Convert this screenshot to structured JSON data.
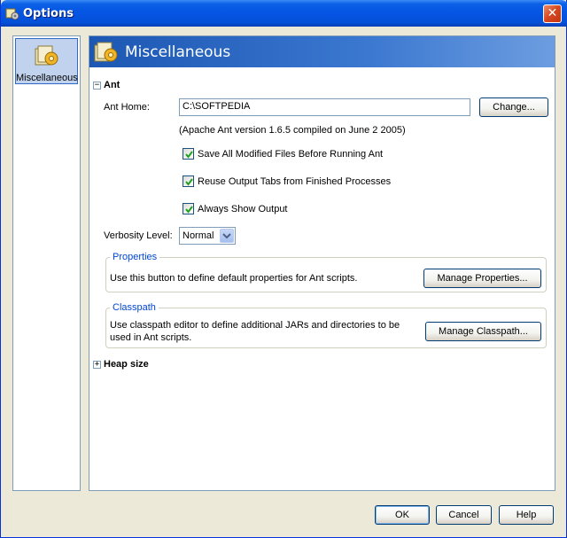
{
  "window": {
    "title": "Options",
    "close_glyph": "✕"
  },
  "categories": [
    {
      "label": "Miscellaneous",
      "icon": "gear-folder-icon",
      "selected": true
    }
  ],
  "panel": {
    "title": "Miscellaneous",
    "ant": {
      "section_label": "Ant",
      "expander": "−",
      "ant_home_label": "Ant Home:",
      "ant_home_value": "C:\\SOFTPEDIA",
      "change_button": "Change...",
      "version_info": "(Apache Ant version 1.6.5 compiled on June 2 2005)",
      "checkboxes": [
        {
          "label": "Save All Modified Files Before Running Ant",
          "checked": true
        },
        {
          "label": "Reuse Output Tabs from Finished Processes",
          "checked": true
        },
        {
          "label": "Always Show Output",
          "checked": true
        }
      ],
      "verbosity_label": "Verbosity Level:",
      "verbosity_value": "Normal",
      "properties": {
        "legend": "Properties",
        "description": "Use this button to define default properties for Ant scripts.",
        "button": "Manage Properties..."
      },
      "classpath": {
        "legend": "Classpath",
        "description_line1": "Use classpath editor to define additional JARs and directories to be",
        "description_line2": "used in Ant scripts.",
        "button": "Manage Classpath..."
      }
    },
    "heap": {
      "section_label": "Heap size",
      "expander": "+"
    }
  },
  "footer": {
    "ok": "OK",
    "cancel": "Cancel",
    "help": "Help"
  },
  "colors": {
    "titlebar": "#0554e3",
    "selection": "#c1d2ee",
    "group_legend": "#0046d5"
  }
}
